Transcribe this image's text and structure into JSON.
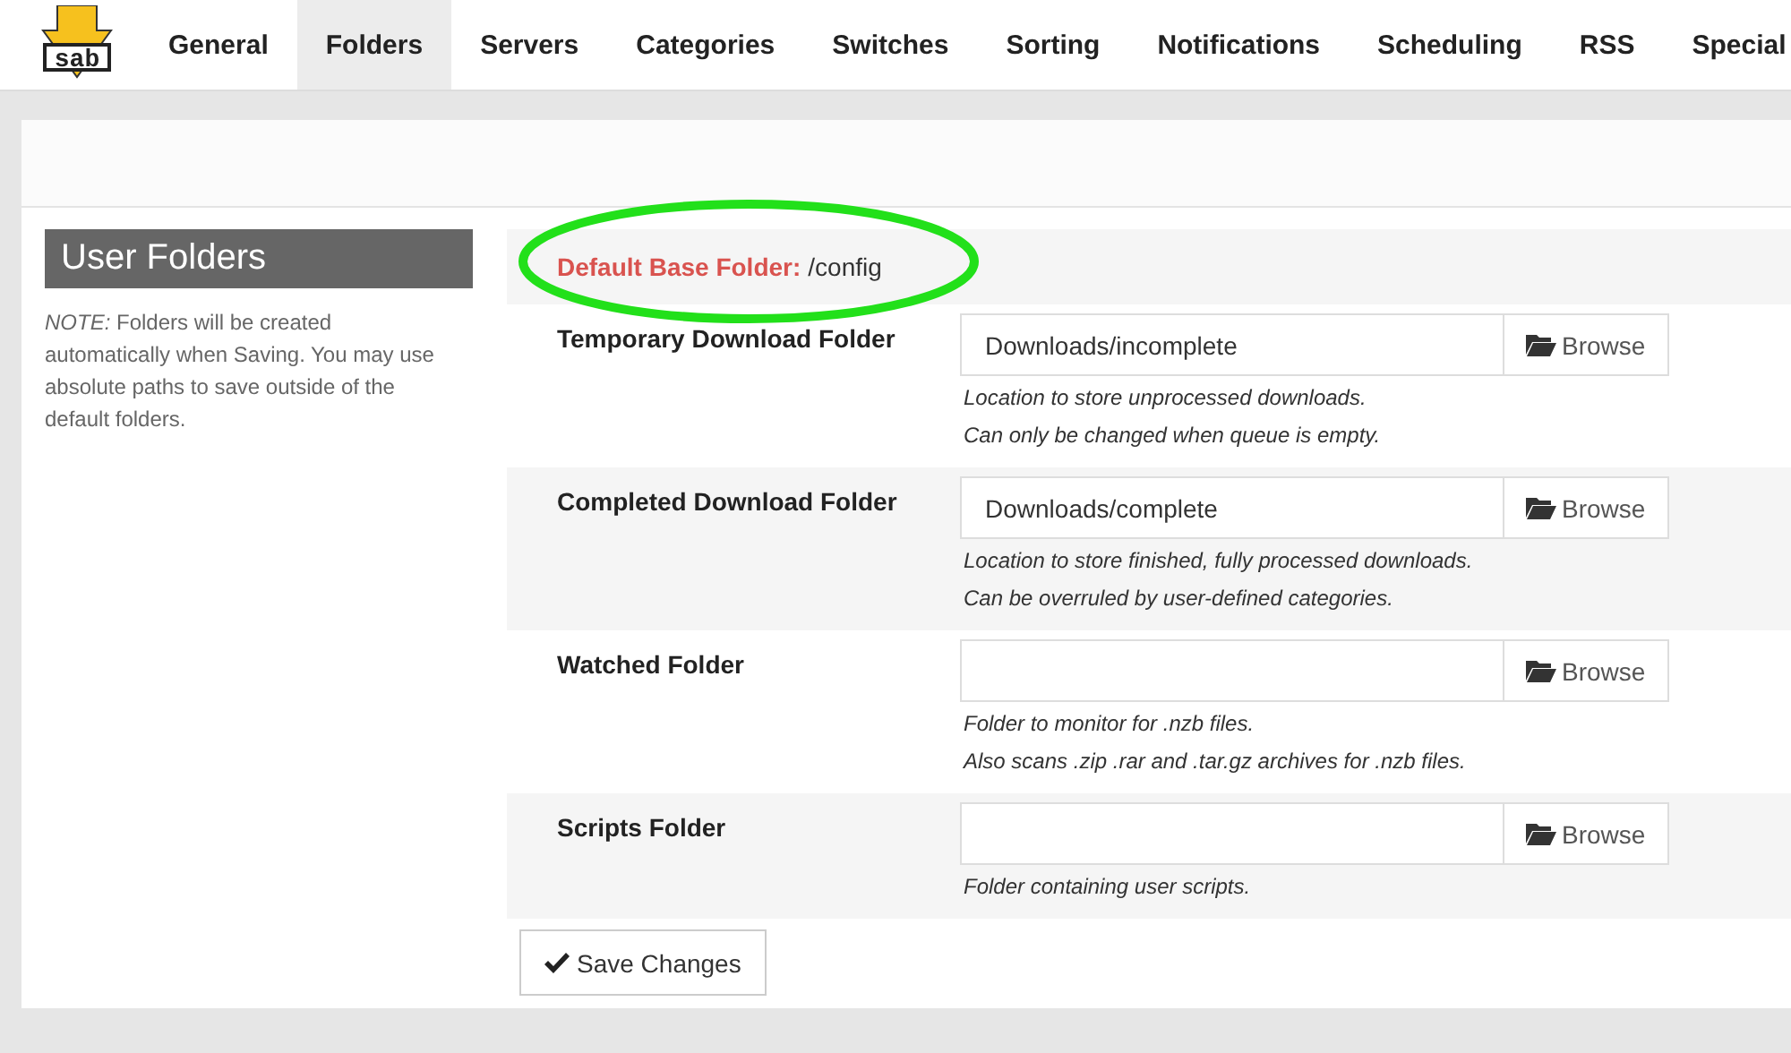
{
  "logo": {
    "text": "sab"
  },
  "tabs": [
    {
      "label": "General",
      "selected": false
    },
    {
      "label": "Folders",
      "selected": true
    },
    {
      "label": "Servers",
      "selected": false
    },
    {
      "label": "Categories",
      "selected": false
    },
    {
      "label": "Switches",
      "selected": false
    },
    {
      "label": "Sorting",
      "selected": false
    },
    {
      "label": "Notifications",
      "selected": false
    },
    {
      "label": "Scheduling",
      "selected": false
    },
    {
      "label": "RSS",
      "selected": false
    },
    {
      "label": "Special",
      "selected": false
    }
  ],
  "section": {
    "title": "User Folders",
    "note_label": "NOTE:",
    "note": "Folders will be created automatically when Saving. You may use absolute paths to save outside of the default folders."
  },
  "base_folder": {
    "label": "Default Base Folder:",
    "value": "/config",
    "highlighted": true
  },
  "folders": [
    {
      "label": "Temporary Download Folder",
      "value": "Downloads/incomplete",
      "button": "Browse",
      "help": [
        "Location to store unprocessed downloads.",
        "Can only be changed when queue is empty."
      ]
    },
    {
      "label": "Completed Download Folder",
      "value": "Downloads/complete",
      "button": "Browse",
      "help": [
        "Location to store finished, fully processed downloads.",
        "Can be overruled by user-defined categories."
      ]
    },
    {
      "label": "Watched Folder",
      "button": "Browse",
      "help": [
        "Folder to monitor for .nzb files.",
        "Also scans .zip .rar and .tar.gz archives for .nzb files."
      ]
    },
    {
      "label": "Scripts Folder",
      "button": "Browse",
      "help": [
        "Folder containing user scripts."
      ]
    }
  ],
  "save_button": "Save Changes"
}
